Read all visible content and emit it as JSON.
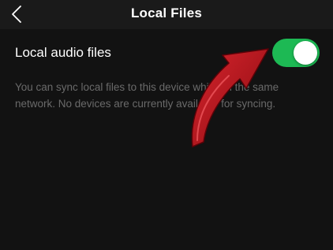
{
  "header": {
    "title": "Local Files",
    "back_icon": "chevron-left-icon"
  },
  "setting": {
    "label": "Local audio files",
    "toggle_state": "on",
    "toggle_color": "#1db954"
  },
  "description": {
    "text": "You can sync local files to this device while on the same network. No devices are currently available for syncing."
  },
  "colors": {
    "background": "#121212",
    "accent": "#1db954",
    "annotation_arrow": "#b0121b"
  }
}
